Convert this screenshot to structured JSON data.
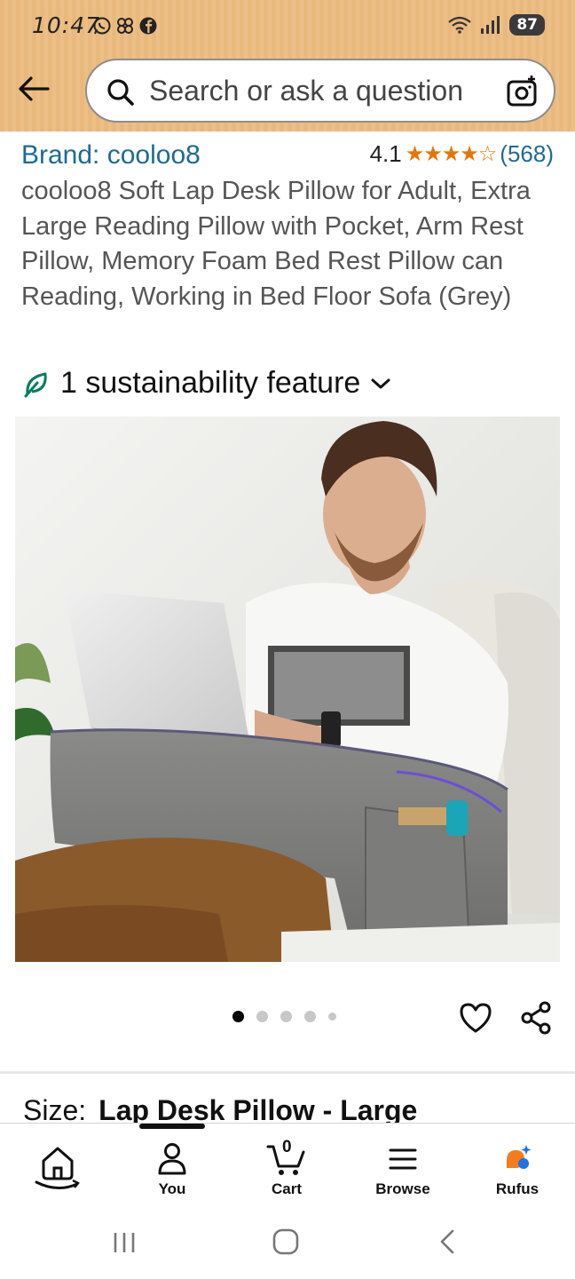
{
  "status_bar": {
    "time": "10:47",
    "battery": "87"
  },
  "header": {
    "search_placeholder": "Search or ask a question"
  },
  "product": {
    "brand": "Brand: cooloo8",
    "rating_value": "4.1",
    "rating_stars": 4.1,
    "review_count": "(568)",
    "title": "cooloo8 Soft Lap Desk Pillow for Adult, Extra Large Reading Pillow with Pocket, Arm Rest Pillow, Memory Foam Bed Rest Pillow can Reading, Working in Bed Floor Sofa (Grey)",
    "sustainability": "1 sustainability feature",
    "size_label": "Size:",
    "size_value": "Lap Desk Pillow - Large"
  },
  "carousel": {
    "count": 5,
    "active_index": 1
  },
  "bottom_nav": {
    "items": [
      {
        "label": "",
        "icon": "home-icon"
      },
      {
        "label": "You",
        "icon": "person-icon"
      },
      {
        "label": "Cart",
        "icon": "cart-icon",
        "badge": "0"
      },
      {
        "label": "Browse",
        "icon": "menu-icon"
      },
      {
        "label": "Rufus",
        "icon": "rufus-icon"
      }
    ]
  },
  "colors": {
    "header_bg": "#e9b87d",
    "link": "#1d6b94",
    "star": "#e77600",
    "sustain_green": "#067d62"
  }
}
